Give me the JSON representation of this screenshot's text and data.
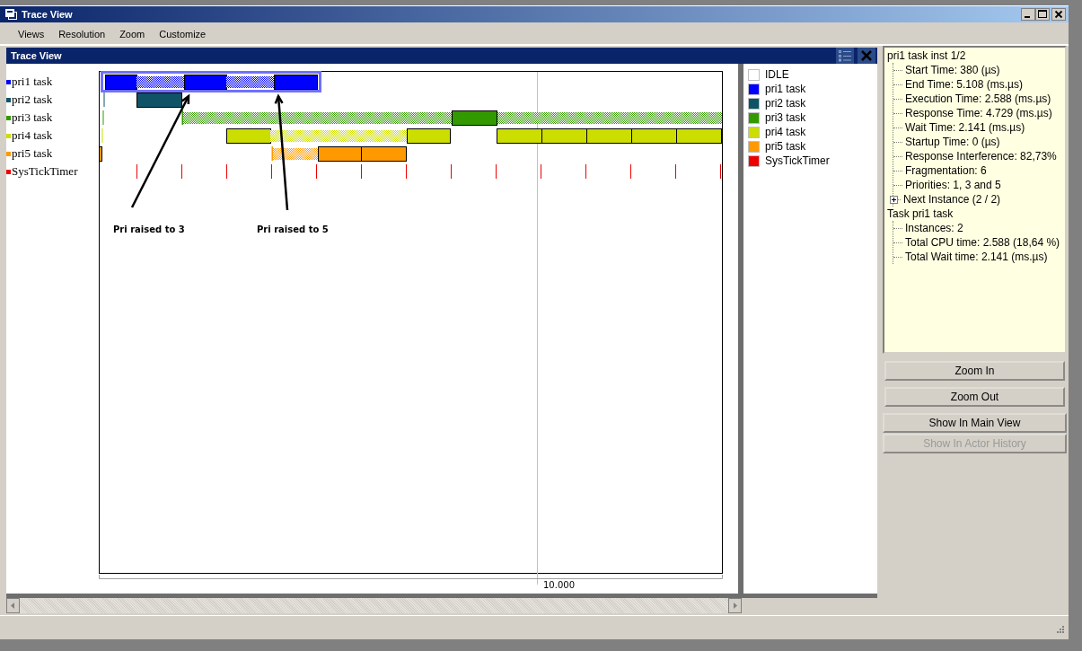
{
  "window": {
    "title": "Trace View"
  },
  "menu": [
    "Views",
    "Resolution",
    "Zoom",
    "Customize"
  ],
  "panel": {
    "title": "Trace View"
  },
  "trace": {
    "rows": [
      {
        "label": "pri1 task",
        "color": "#0000ff"
      },
      {
        "label": "pri2 task",
        "color": "#0e5466"
      },
      {
        "label": "pri3 task",
        "color": "#339900"
      },
      {
        "label": "pri4 task",
        "color": "#ccdd00"
      },
      {
        "label": "pri5 task",
        "color": "#ff9900"
      },
      {
        "label": "SysTickTimer",
        "color": "#ee0000"
      }
    ],
    "axis_label": "10.000",
    "annotations": [
      "Pri raised to 3",
      "Pri raised to 5"
    ]
  },
  "legend": [
    {
      "label": "IDLE",
      "color": "#ffffff"
    },
    {
      "label": "pri1 task",
      "color": "#0000ff"
    },
    {
      "label": "pri2 task",
      "color": "#0e5466"
    },
    {
      "label": "pri3 task",
      "color": "#339900"
    },
    {
      "label": "pri4 task",
      "color": "#ccdd00"
    },
    {
      "label": "pri5 task",
      "color": "#ff9900"
    },
    {
      "label": "SysTickTimer",
      "color": "#ee0000"
    }
  ],
  "info_tree": [
    {
      "label": "pri1 task inst 1/2",
      "children": [
        {
          "label": "Start Time: 380 (µs)"
        },
        {
          "label": "End Time: 5.108 (ms.µs)"
        },
        {
          "label": "Execution Time: 2.588 (ms.µs)"
        },
        {
          "label": "Response Time: 4.729 (ms.µs)"
        },
        {
          "label": "Wait Time: 2.141 (ms.µs)"
        },
        {
          "label": "Startup Time: 0 (µs)"
        },
        {
          "label": "Response Interference: 82,73%"
        },
        {
          "label": "Fragmentation: 6"
        },
        {
          "label": "Priorities: 1, 3 and 5"
        },
        {
          "label": "Next Instance (2 / 2)",
          "expanded": false
        }
      ]
    },
    {
      "label": "Task pri1 task",
      "children": [
        {
          "label": "Instances: 2"
        },
        {
          "label": "Total CPU time: 2.588 (18,64 %)"
        },
        {
          "label": "Total Wait time: 2.141 (ms.µs)"
        }
      ]
    }
  ],
  "buttons": [
    {
      "label": "Zoom In",
      "disabled": false
    },
    {
      "label": "Zoom Out",
      "disabled": false
    },
    {
      "label": "Show In Main View",
      "disabled": false
    },
    {
      "label": "Show In Actor History",
      "disabled": true
    }
  ]
}
